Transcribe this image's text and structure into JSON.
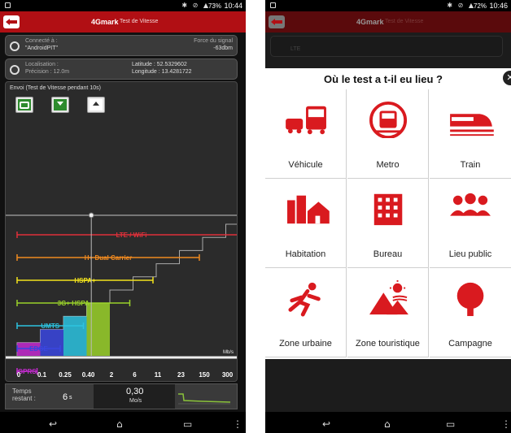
{
  "left_screen": {
    "status": {
      "time": "10:44",
      "battery": "73%"
    },
    "app_bar": {
      "title": "4Gmark",
      "subtitle": "Test de Vitesse"
    },
    "connection": {
      "label": "Connecté à :",
      "network": "\"AndroidPIT\"",
      "signal_label": "Force du signal",
      "signal_value": "-63dbm"
    },
    "location": {
      "label": "Localisation :",
      "precision": "Précision : 12.0m",
      "latitude": "Latitude : 52.5329602",
      "longitude": "Longitude : 13.4281722"
    },
    "test_panel": {
      "header": "Envoi (Test de Vitesse pendant 10s)",
      "buttons": [
        "sync-icon",
        "download-icon",
        "upload-icon"
      ]
    },
    "chart_data": {
      "type": "bar",
      "title": "",
      "unit_label": "Mb/s",
      "categories": [
        "0",
        "0.1",
        "0.25",
        "0.40",
        "2",
        "6",
        "11",
        "23",
        "150",
        "300"
      ],
      "technologies": [
        {
          "name": "LTE / WiFi",
          "color": "#e0303a"
        },
        {
          "name": "H+ Dual Carrier",
          "color": "#f08a20"
        },
        {
          "name": "HSPA+",
          "color": "#f2e21c"
        },
        {
          "name": "3G+ HSPA",
          "color": "#9ad12a"
        },
        {
          "name": "UMTS",
          "color": "#2cc3e0"
        },
        {
          "name": "EDGE",
          "color": "#3a46e0"
        },
        {
          "name": "GPRS",
          "color": "#c42ad0"
        }
      ],
      "measured_value": 0.3
    },
    "bottom": {
      "temps_label": "Temps restant :",
      "temps_value": "6",
      "temps_unit": "s",
      "speed_value": "0,30",
      "speed_unit": "Mo/s"
    }
  },
  "right_screen": {
    "status": {
      "time": "10:46",
      "battery": "72%"
    },
    "app_bar": {
      "title": "4Gmark",
      "subtitle": "Test de Vitesse"
    },
    "background_row": {
      "label": "LTE"
    },
    "dialog": {
      "title": "Où le test a t-il eu lieu ?",
      "options": [
        {
          "label": "Véhicule",
          "icon": "vehicle-icon"
        },
        {
          "label": "Metro",
          "icon": "metro-icon"
        },
        {
          "label": "Train",
          "icon": "train-icon"
        },
        {
          "label": "Habitation",
          "icon": "house-icon"
        },
        {
          "label": "Bureau",
          "icon": "office-building-icon"
        },
        {
          "label": "Lieu public",
          "icon": "people-group-icon"
        },
        {
          "label": "Zone urbaine",
          "icon": "running-person-icon"
        },
        {
          "label": "Zone touristique",
          "icon": "landscape-icon"
        },
        {
          "label": "Campagne",
          "icon": "tree-icon"
        }
      ],
      "accent_color": "#d91a1f"
    }
  }
}
